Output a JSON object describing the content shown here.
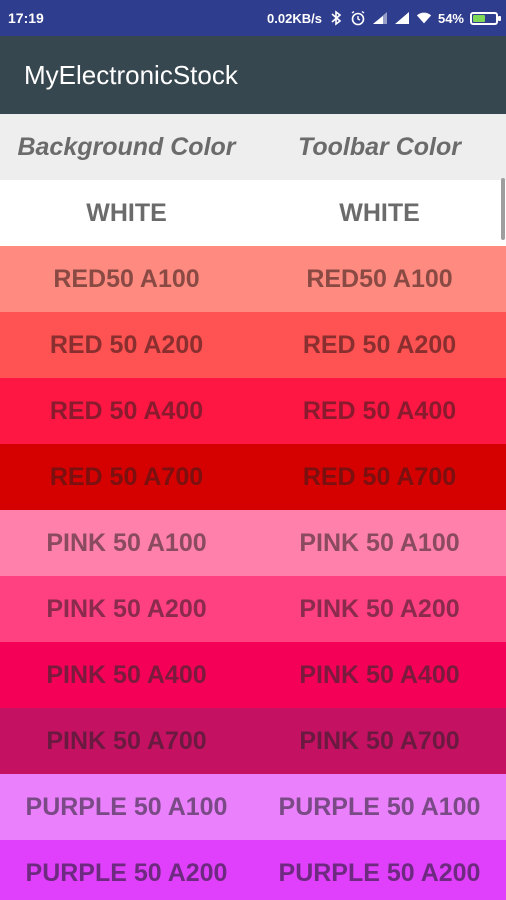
{
  "status_bar": {
    "time": "17:19",
    "network_speed": "0.02KB/s",
    "battery_percent": "54%",
    "battery_level": 0.54,
    "icons": [
      "bluetooth-icon",
      "alarm-icon",
      "signal-icon",
      "signal-icon",
      "wifi-icon",
      "battery-icon"
    ]
  },
  "app_bar": {
    "title": "MyElectronicStock"
  },
  "table": {
    "headers": [
      "Background Color",
      "Toolbar Color"
    ],
    "rows": [
      {
        "bg_label": "WHITE",
        "toolbar_label": "WHITE",
        "color": "#ffffff",
        "text_color": "#6b6b6b"
      },
      {
        "bg_label": "RED50 A100",
        "toolbar_label": "RED50 A100",
        "color": "#ff8a80",
        "text_color": "#8a4a44"
      },
      {
        "bg_label": "RED 50 A200",
        "toolbar_label": "RED 50 A200",
        "color": "#ff5252",
        "text_color": "#8a2f2f"
      },
      {
        "bg_label": "RED 50 A400",
        "toolbar_label": "RED 50 A400",
        "color": "#ff1744",
        "text_color": "#8a1a2e"
      },
      {
        "bg_label": "RED 50 A700",
        "toolbar_label": "RED 50 A700",
        "color": "#d50000",
        "text_color": "#7a1010"
      },
      {
        "bg_label": "PINK 50 A100",
        "toolbar_label": "PINK 50 A100",
        "color": "#ff80ab",
        "text_color": "#8a4a60"
      },
      {
        "bg_label": "PINK 50 A200",
        "toolbar_label": "PINK 50 A200",
        "color": "#ff4081",
        "text_color": "#8a2a4c"
      },
      {
        "bg_label": "PINK 50 A400",
        "toolbar_label": "PINK 50 A400",
        "color": "#f50057",
        "text_color": "#7a1a3c"
      },
      {
        "bg_label": "PINK 50 A700",
        "toolbar_label": "PINK 50 A700",
        "color": "#c51162",
        "text_color": "#6a1a40"
      },
      {
        "bg_label": "PURPLE 50 A100",
        "toolbar_label": "PURPLE 50 A100",
        "color": "#ea80fc",
        "text_color": "#7a4a86"
      },
      {
        "bg_label": "PURPLE 50 A200",
        "toolbar_label": "PURPLE 50 A200",
        "color": "#e040fb",
        "text_color": "#6e2a80"
      }
    ]
  }
}
